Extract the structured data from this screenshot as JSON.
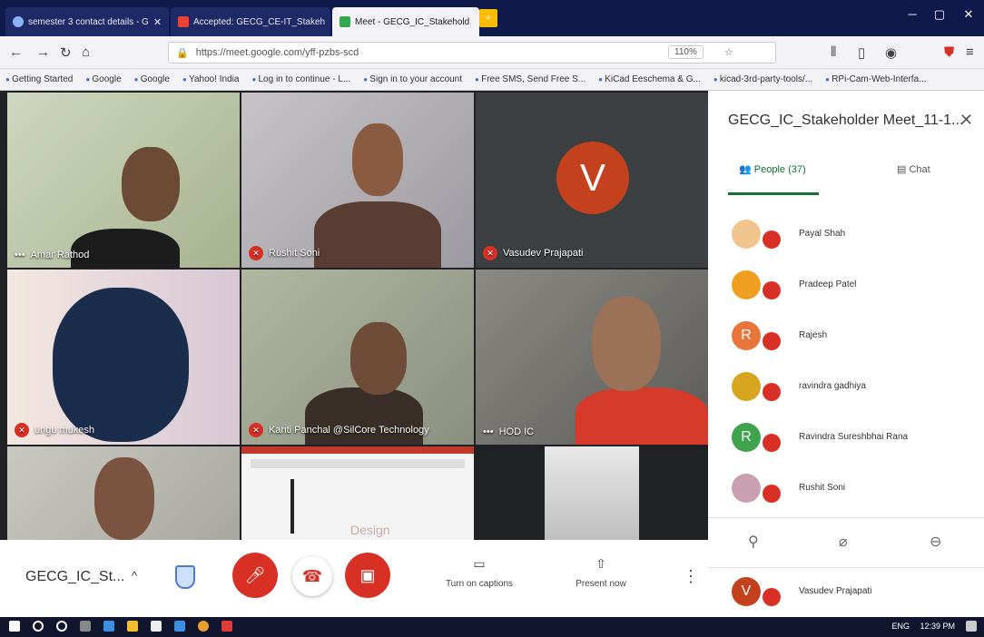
{
  "browser": {
    "tabs": [
      {
        "title": "semester 3 contact details - G",
        "active": false
      },
      {
        "title": "Accepted: GECG_CE-IT_Stakeh",
        "active": false
      },
      {
        "title": "Meet - GECG_IC_Stakehold",
        "active": true
      }
    ],
    "url": "https://meet.google.com/yff-pzbs-scd",
    "url_domain": "meet.google.com",
    "zoom": "110%",
    "bookmarks": [
      "Getting Started",
      "Google",
      "Google",
      "Yahoo! India",
      "Log in to continue - L...",
      "Sign in to your account",
      "Free SMS, Send Free S...",
      "KiCad Eeschema & G...",
      "kicad-3rd-party-tools/...",
      "RPi-Cam-Web-Interfa..."
    ]
  },
  "tiles": [
    {
      "name": "Amar Rathod"
    },
    {
      "name": "Rushit Soni"
    },
    {
      "name": "Vasudev Prajapati",
      "initial": "V"
    },
    {
      "name": "ungu mukesh"
    },
    {
      "name": "Kanti Panchal @SilCore Technology"
    },
    {
      "name": "HOD IC"
    },
    {
      "name": ""
    },
    {
      "name": "",
      "slide_text": "Design"
    },
    {
      "name": ""
    }
  ],
  "panel": {
    "title": "GECG_IC_Stakeholder Meet_11-1...",
    "tab_people": "People (37)",
    "tab_chat": "Chat",
    "people": [
      {
        "name": "Payal Shah",
        "initial": "",
        "color": "#f3c58e"
      },
      {
        "name": "Pradeep Patel",
        "initial": "",
        "color": "#f0a020"
      },
      {
        "name": "Rajesh",
        "initial": "R",
        "color": "#e8753a"
      },
      {
        "name": "ravindra gadhiya",
        "initial": "",
        "color": "#d8a520"
      },
      {
        "name": "Ravindra Sureshbhai Rana",
        "initial": "R",
        "color": "#3fa34d"
      },
      {
        "name": "Rushit Soni",
        "initial": "",
        "color": "#c8a0b0"
      },
      {
        "name": "Vasudev Prajapati",
        "initial": "V",
        "color": "#c3421d"
      }
    ]
  },
  "bottom": {
    "meeting_name": "GECG_IC_St...",
    "captions_label": "Turn on captions",
    "present_label": "Present now"
  },
  "taskbar": {
    "time": "12:39 PM",
    "lang": "ENG"
  },
  "colors": {
    "accent": "#137333",
    "mute_red": "#d93025",
    "avatar_v": "#c3421d"
  }
}
